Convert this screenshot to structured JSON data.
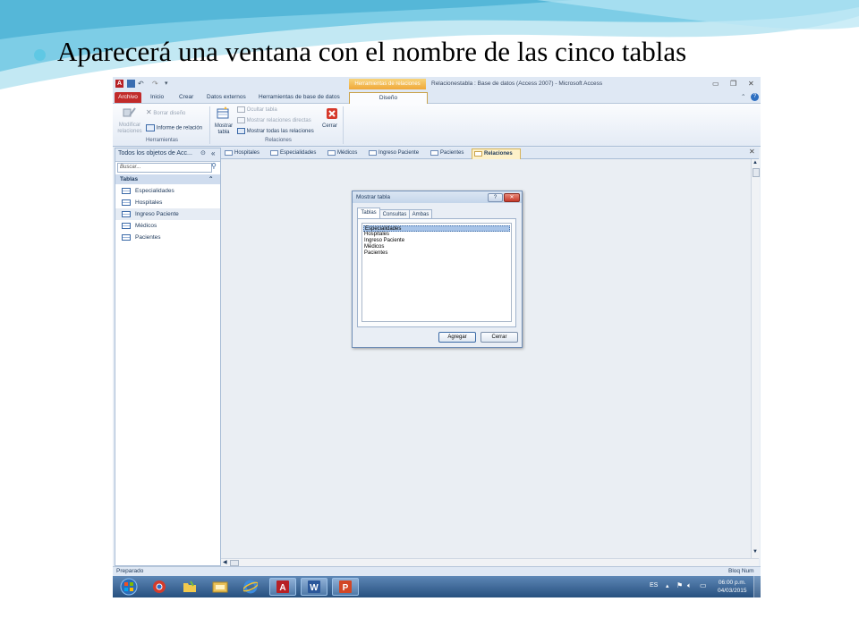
{
  "slide": {
    "title": "Aparecerá una ventana con el nombre de las cinco tablas"
  },
  "window": {
    "title": "Relacionestabla : Base de datos (Access 2007) - Microsoft Access",
    "context_tab_header": "Herramientas de relaciones",
    "menu_tabs": [
      "Archivo",
      "Inicio",
      "Crear",
      "Datos externos",
      "Herramientas de base de datos",
      "Diseño"
    ],
    "accent_color": "#c12b2b"
  },
  "ribbon": {
    "tools": {
      "modificar_relaciones": "Modificar relaciones",
      "borrar_diseno": "Borrar diseño",
      "informe_relacion": "Informe de relación",
      "group_label": "Herramientas"
    },
    "relaciones": {
      "mostrar_tabla": "Mostrar tabla",
      "ocultar_tabla": "Ocultar tabla",
      "mostrar_relaciones_directas": "Mostrar relaciones directas",
      "mostrar_todas": "Mostrar todas las relaciones",
      "cerrar": "Cerrar",
      "group_label": "Relaciones"
    }
  },
  "nav": {
    "header": "Todos los objetos de Acc...",
    "search_placeholder": "Buscar...",
    "group": "Tablas",
    "items": [
      "Especialidades",
      "Hospitales",
      "Ingreso Paciente",
      "Médicos",
      "Pacientes"
    ],
    "selected": "Ingreso Paciente"
  },
  "doc_tabs": [
    "Hospitales",
    "Especialidades",
    "Médicos",
    "Ingreso Paciente",
    "Pacientes",
    "Relaciones"
  ],
  "active_doc_tab": "Relaciones",
  "status": {
    "left": "Preparado",
    "right": "Bloq Num"
  },
  "dialog": {
    "title": "Mostrar tabla",
    "tabs": [
      "Tablas",
      "Consultas",
      "Ambas"
    ],
    "items": [
      "Especialidades",
      "Hospitales",
      "Ingreso Paciente",
      "Médicos",
      "Pacientes"
    ],
    "selected": "Especialidades",
    "add_button": "Agregar",
    "close_button": "Cerrar",
    "help_button": "?"
  },
  "taskbar": {
    "lang": "ES",
    "time": "06:00 p.m.",
    "date": "04/03/2015",
    "apps": [
      "start",
      "chrome",
      "folder-pinned",
      "explorer",
      "ie",
      "access",
      "word",
      "powerpoint"
    ]
  }
}
